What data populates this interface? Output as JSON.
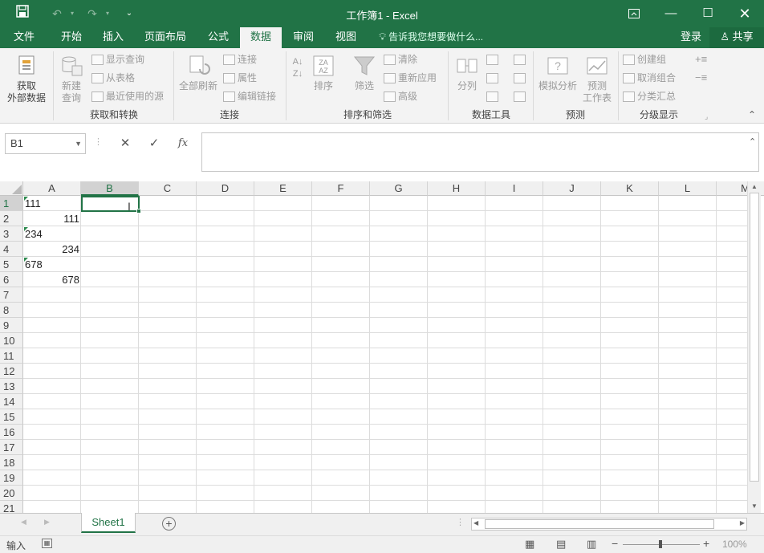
{
  "title_bar": {
    "title": "工作簿1 - Excel"
  },
  "tabs": [
    {
      "label": "文件"
    },
    {
      "label": "开始"
    },
    {
      "label": "插入"
    },
    {
      "label": "页面布局"
    },
    {
      "label": "公式"
    },
    {
      "label": "数据",
      "active": true
    },
    {
      "label": "审阅"
    },
    {
      "label": "视图"
    }
  ],
  "tell_me": "告诉我您想要做什么...",
  "login": "登录",
  "share": "共享",
  "ribbon": {
    "get_transform": {
      "group_label": "获取和转换",
      "get_external_line1": "获取",
      "get_external_line2": "外部数据",
      "new_query_line1": "新建",
      "new_query_line2": "查询",
      "show_queries": "显示查询",
      "from_table": "从表格",
      "recent_sources": "最近使用的源"
    },
    "connections": {
      "group_label": "连接",
      "refresh_all": "全部刷新",
      "connections": "连接",
      "properties": "属性",
      "edit_links": "编辑链接"
    },
    "sort_filter": {
      "group_label": "排序和筛选",
      "sort": "排序",
      "filter": "筛选",
      "clear": "清除",
      "reapply": "重新应用",
      "advanced": "高级"
    },
    "data_tools": {
      "group_label": "数据工具",
      "text_to_columns": "分列"
    },
    "forecast": {
      "group_label": "预测",
      "what_if_line1": "模拟分析",
      "forecast_sheet_line1": "预测",
      "forecast_sheet_line2": "工作表"
    },
    "outline": {
      "group_label": "分级显示",
      "group": "创建组",
      "ungroup": "取消组合",
      "subtotal": "分类汇总"
    }
  },
  "formula_bar": {
    "name_box": "B1",
    "fx": "fx",
    "content": ""
  },
  "columns": [
    "A",
    "B",
    "C",
    "D",
    "E",
    "F",
    "G",
    "H",
    "I",
    "J",
    "K",
    "L",
    "M"
  ],
  "rows": [
    "1",
    "2",
    "3",
    "4",
    "5",
    "6",
    "7",
    "8",
    "9",
    "10",
    "11",
    "12",
    "13",
    "14",
    "15",
    "16",
    "17",
    "18",
    "19",
    "20",
    "21"
  ],
  "cells": [
    {
      "ref": "A1",
      "value": "111",
      "align": "left",
      "text_flag": true
    },
    {
      "ref": "A2",
      "value": "111",
      "align": "right"
    },
    {
      "ref": "A3",
      "value": "234",
      "align": "left",
      "text_flag": true
    },
    {
      "ref": "A4",
      "value": "234",
      "align": "right"
    },
    {
      "ref": "A5",
      "value": "678",
      "align": "left",
      "text_flag": true
    },
    {
      "ref": "A6",
      "value": "678",
      "align": "right"
    }
  ],
  "selected_cell": "B1",
  "sheet_tabs": [
    {
      "label": "Sheet1",
      "active": true
    }
  ],
  "status": {
    "mode": "输入",
    "zoom": "100%"
  },
  "colors": {
    "accent": "#217346",
    "text_flag": "#2d8a4e"
  }
}
